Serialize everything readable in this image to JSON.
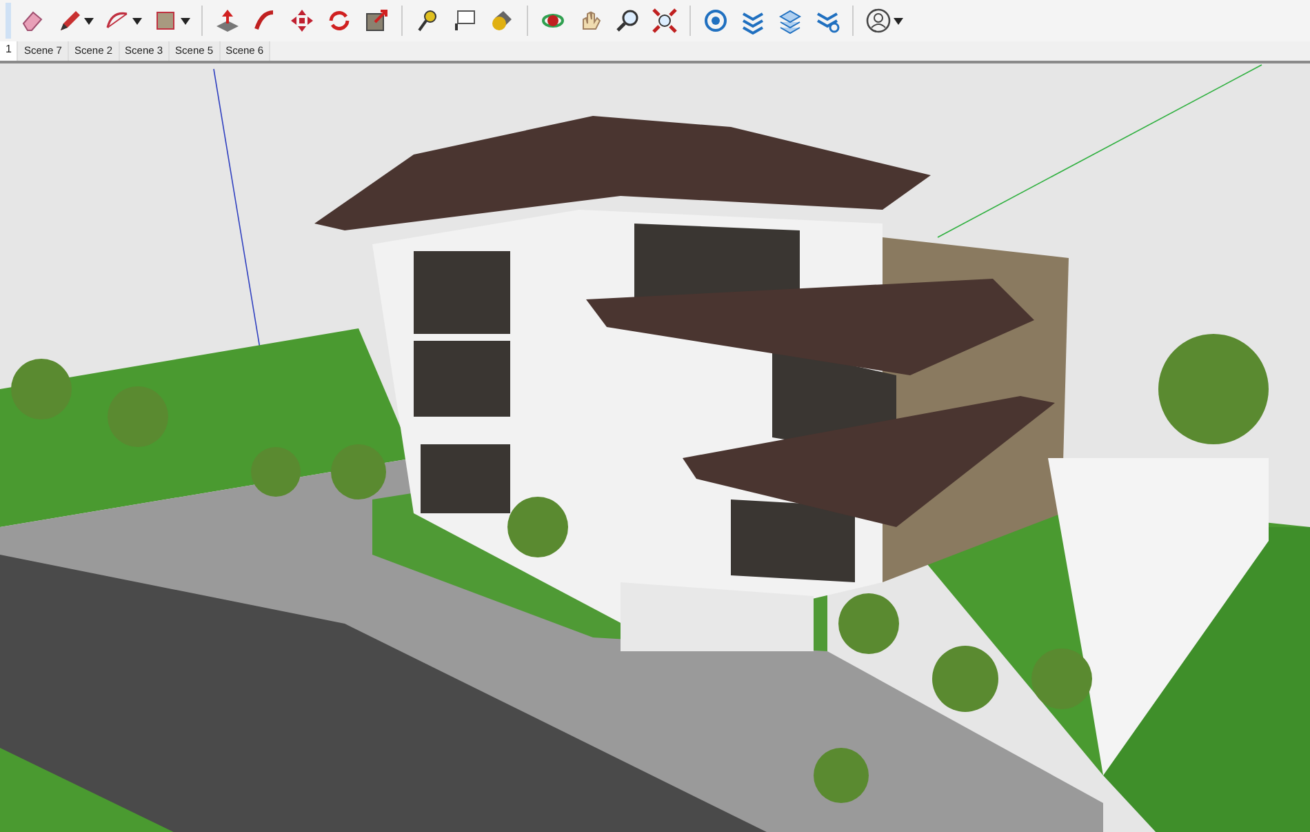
{
  "scene_tabs": [
    {
      "label": "1",
      "selected": true
    },
    {
      "label": "Scene 7",
      "selected": false
    },
    {
      "label": "Scene 2",
      "selected": false
    },
    {
      "label": "Scene 3",
      "selected": false
    },
    {
      "label": "Scene 5",
      "selected": false
    },
    {
      "label": "Scene 6",
      "selected": false
    }
  ]
}
